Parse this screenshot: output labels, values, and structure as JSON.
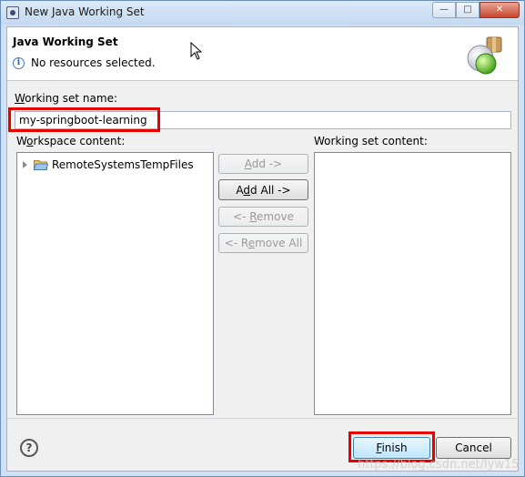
{
  "window": {
    "title": "New Java Working Set",
    "controls": {
      "minimize": "—",
      "maximize": "□",
      "close": "✕"
    }
  },
  "header": {
    "title": "Java Working Set",
    "message": "No resources selected.",
    "info_icon_glyph": "i"
  },
  "form": {
    "name_label_mnemonic": "W",
    "name_label_rest": "orking set name:",
    "name_value": "my-springboot-learning",
    "workspace_label_pre": "W",
    "workspace_label_mnemonic": "o",
    "workspace_label_rest": "rkspace content:",
    "working_set_label": "Working set content:"
  },
  "workspace_tree": {
    "items": [
      {
        "label": "RemoteSystemsTempFiles"
      }
    ]
  },
  "transfer_buttons": {
    "add": {
      "mnemonic": "A",
      "rest": "dd ->"
    },
    "add_all": {
      "pre": "A",
      "mnemonic": "d",
      "rest": "d All ->"
    },
    "remove": {
      "pre": "<- ",
      "mnemonic": "R",
      "rest": "emove"
    },
    "remove_all": {
      "pre": "<- R",
      "mnemonic": "e",
      "rest": "move All"
    }
  },
  "footer": {
    "help_glyph": "?",
    "finish": {
      "mnemonic": "F",
      "rest": "inish"
    },
    "cancel": "Cancel"
  },
  "watermark": "https://blog.csdn.net/lyw15",
  "colors": {
    "highlight": "#e60000",
    "default_button": "#bee6fd",
    "disabled_text": "#9a9a9a"
  }
}
